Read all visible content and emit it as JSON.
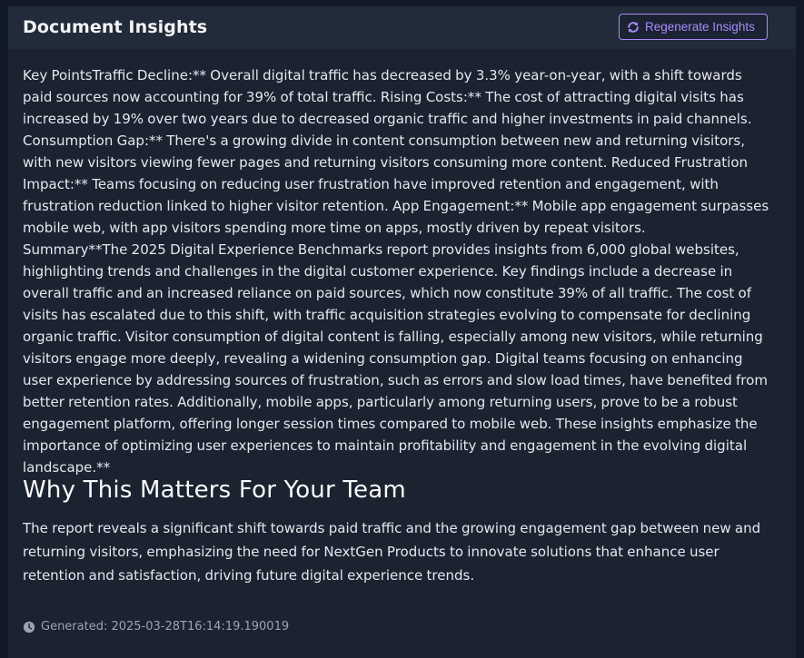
{
  "header": {
    "title": "Document Insights",
    "regenerate_label": "Regenerate Insights",
    "regenerate_icon": "refresh-icon"
  },
  "key_points": "Key PointsTraffic Decline:** Overall digital traffic has decreased by 3.3% year-on-year, with a shift towards paid sources now accounting for 39% of total traffic. Rising Costs:** The cost of attracting digital visits has increased by 19% over two years due to decreased organic traffic and higher investments in paid channels. Consumption Gap:** There's a growing divide in content consumption between new and returning visitors, with new visitors viewing fewer pages and returning visitors consuming more content. Reduced Frustration Impact:** Teams focusing on reducing user frustration have improved retention and engagement, with frustration reduction linked to higher visitor retention. App Engagement:** Mobile app engagement surpasses mobile web, with app visitors spending more time on apps, mostly driven by repeat visitors.",
  "summary": "Summary**The 2025 Digital Experience Benchmarks report provides insights from 6,000 global websites, highlighting trends and challenges in the digital customer experience. Key findings include a decrease in overall traffic and an increased reliance on paid sources, which now constitute 39% of all traffic. The cost of visits has escalated due to this shift, with traffic acquisition strategies evolving to compensate for declining organic traffic. Visitor consumption of digital content is falling, especially among new visitors, while returning visitors engage more deeply, revealing a widening consumption gap. Digital teams focusing on enhancing user experience by addressing sources of frustration, such as errors and slow load times, have benefited from better retention rates. Additionally, mobile apps, particularly among returning users, prove to be a robust engagement platform, offering longer session times compared to mobile web. These insights emphasize the importance of optimizing user experiences to maintain profitability and engagement in the evolving digital landscape.**",
  "why_section": {
    "heading": "Why This Matters For Your Team",
    "text": "The report reveals a significant shift towards paid traffic and the growing engagement gap between new and returning visitors, emphasizing the need for NextGen Products to innovate solutions that enhance user retention and satisfaction, driving future digital experience trends."
  },
  "footer": {
    "generated_label": "Generated: 2025-03-28T16:14:19.190019",
    "clock_icon": "clock-icon"
  },
  "colors": {
    "background": "#111827",
    "panel": "#1b2331",
    "header": "#222b3a",
    "accent": "#a78bfa",
    "text": "#e5e7eb",
    "muted": "#9ca3af"
  }
}
